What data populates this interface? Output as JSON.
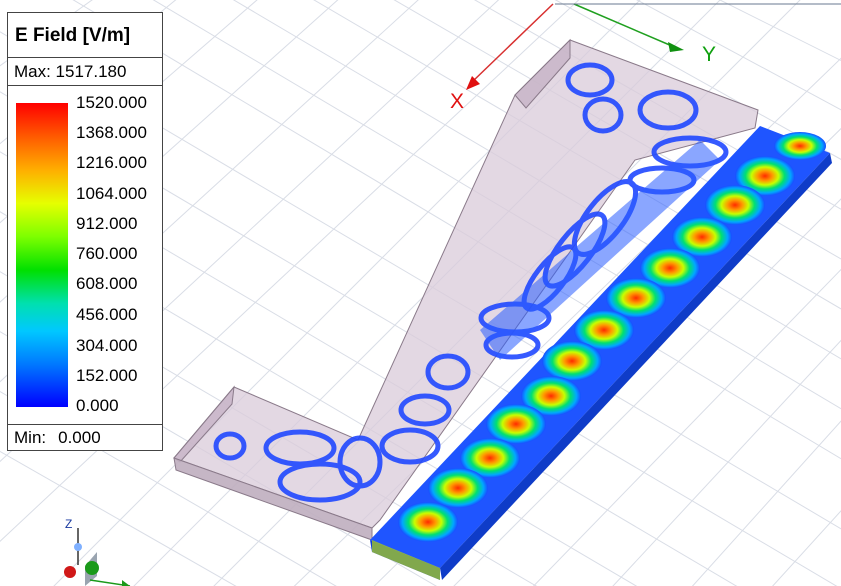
{
  "legend": {
    "title": "E Field [V/m]",
    "max_label": "Max: 1517.180",
    "min_label": "Min:",
    "min_value": "0.000",
    "ticks": [
      "1520.000",
      "1368.000",
      "1216.000",
      "1064.000",
      "912.000",
      "760.000",
      "608.000",
      "456.000",
      "304.000",
      "152.000",
      "0.000"
    ]
  },
  "axes": {
    "x": "X",
    "y": "Y",
    "z": "Z"
  },
  "colors": {
    "x_axis": "#e01010",
    "y_axis": "#10a010",
    "grid": "#d8dce4",
    "body": "#c9b9c9"
  }
}
